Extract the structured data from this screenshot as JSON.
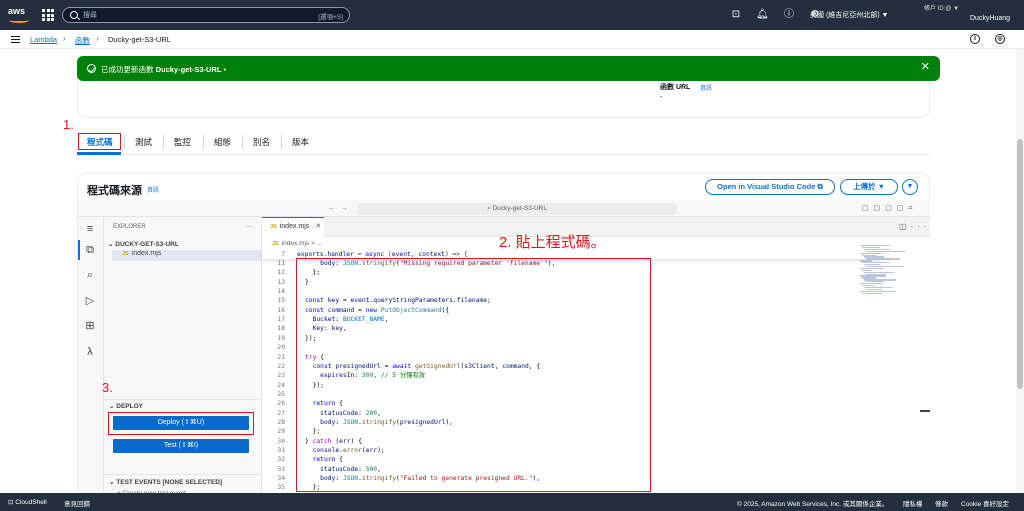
{
  "topnav": {
    "logo": "aws",
    "search_placeholder": "搜尋",
    "search_shortcut": "[選項+S]",
    "region": "美國 (維吉尼亞州北部) ▼",
    "account_id": "帳戶 ID:@ ▼",
    "account_name": "DuckyHuang",
    "icons": [
      "cloudshell-icon",
      "bell-icon",
      "help-icon",
      "gear-icon"
    ]
  },
  "breadcrumb": {
    "root": "Lambda",
    "functions": "函數",
    "current": "Ducky-get-S3-URL"
  },
  "flash": {
    "message_prefix": "已成功更新函數 ",
    "function_name": "Ducky-get-S3-URL",
    "suffix": " •",
    "color": "#037f0c"
  },
  "function_url": {
    "label": "函數 URL",
    "info": "資訊",
    "value": "-"
  },
  "tabs": [
    "程式碼",
    "測試",
    "監控",
    "組態",
    "別名",
    "版本"
  ],
  "annotations": {
    "step1": "1.",
    "step2": "2. 貼上程式碼。",
    "step3": "3."
  },
  "code_source": {
    "title": "程式碼來源",
    "info": "資訊",
    "vscode_button": "Open in Visual Studio Code",
    "upload_button": "上傳於 ▼"
  },
  "ide": {
    "address": "Ducky-get-S3-URL",
    "explorer_title": "EXPLORER",
    "folder": "DUCKY-GET-S3-URL",
    "file": "index.mjs",
    "deploy_section": "DEPLOY",
    "deploy_button": "Deploy (⇧⌘U)",
    "test_button": "Test (⇧⌘I)",
    "test_events": "TEST EVENTS [NONE SELECTED]",
    "create_test_event": "+ Create new test event",
    "tab": "index.mjs",
    "breadcrumb": "index.mjs > ...",
    "sticky_line_no": "7",
    "sticky_code": "exports.handler = async (event, context) => {",
    "code_lines": [
      {
        "n": "11",
        "t": "    body: JSON.stringify(\"Missing required parameter 'filename'\"),"
      },
      {
        "n": "12",
        "t": "  };"
      },
      {
        "n": "13",
        "t": "}"
      },
      {
        "n": "14",
        "t": ""
      },
      {
        "n": "15",
        "t": "const key = event.queryStringParameters.filename;"
      },
      {
        "n": "16",
        "t": "const command = new PutObjectCommand({"
      },
      {
        "n": "17",
        "t": "  Bucket: BUCKET_NAME,"
      },
      {
        "n": "18",
        "t": "  Key: key,"
      },
      {
        "n": "19",
        "t": "});"
      },
      {
        "n": "20",
        "t": ""
      },
      {
        "n": "21",
        "t": "try {"
      },
      {
        "n": "22",
        "t": "  const presignedUrl = await getSignedUrl(s3Client, command, {"
      },
      {
        "n": "23",
        "t": "    expiresIn: 300, // 5 分鐘有效"
      },
      {
        "n": "24",
        "t": "  });"
      },
      {
        "n": "25",
        "t": ""
      },
      {
        "n": "26",
        "t": "  return {"
      },
      {
        "n": "27",
        "t": "    statusCode: 200,"
      },
      {
        "n": "28",
        "t": "    body: JSON.stringify(presignedUrl),"
      },
      {
        "n": "29",
        "t": "  };"
      },
      {
        "n": "30",
        "t": "} catch (err) {"
      },
      {
        "n": "31",
        "t": "  console.error(err);"
      },
      {
        "n": "32",
        "t": "  return {"
      },
      {
        "n": "33",
        "t": "    statusCode: 500,"
      },
      {
        "n": "34",
        "t": "    body: JSON.stringify(\"Failed to generate presigned URL.\"),"
      },
      {
        "n": "35",
        "t": "  };"
      }
    ]
  },
  "footer": {
    "cloudshell": "CloudShell",
    "feedback": "意見回饋",
    "copyright": "© 2025, Amazon Web Services, Inc. 或其關係企業。",
    "privacy": "隱私權",
    "terms": "條款",
    "cookie": "Cookie 喜好設定"
  },
  "colors": {
    "accent": "#0972d3",
    "annotation_red": "#e5141b",
    "nav_bg": "#232f3e",
    "aws_orange": "#ff9900"
  }
}
